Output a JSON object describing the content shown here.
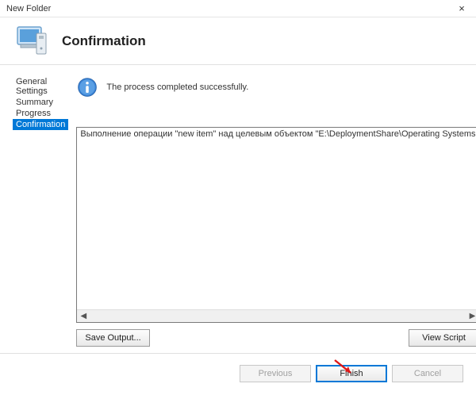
{
  "window": {
    "title": "New Folder",
    "close_glyph": "×"
  },
  "header": {
    "title": "Confirmation"
  },
  "sidebar": {
    "items": [
      {
        "label": "General Settings"
      },
      {
        "label": "Summary"
      },
      {
        "label": "Progress"
      },
      {
        "label": "Confirmation"
      }
    ],
    "selected_index": 3
  },
  "content": {
    "status_message": "The process completed successfully.",
    "output_text": "Выполнение операции \"new item\" над целевым объектом \"E:\\DeploymentShare\\Operating Systems",
    "save_output_label": "Save Output...",
    "view_script_label": "View Script"
  },
  "footer": {
    "previous_label": "Previous",
    "finish_label": "Finish",
    "cancel_label": "Cancel"
  }
}
